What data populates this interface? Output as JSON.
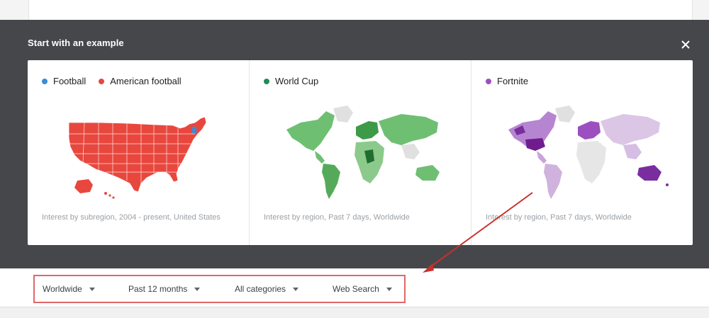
{
  "panel": {
    "title": "Start with an example",
    "close_icon": "close-icon"
  },
  "cards": [
    {
      "legend": [
        {
          "label": "Football",
          "color": "#3b8bd9"
        },
        {
          "label": "American football",
          "color": "#e8473e"
        }
      ],
      "caption": "Interest by subregion, 2004 - present, United States"
    },
    {
      "legend": [
        {
          "label": "World Cup",
          "color": "#1e8e5a"
        }
      ],
      "caption": "Interest by region, Past 7 days, Worldwide"
    },
    {
      "legend": [
        {
          "label": "Fortnite",
          "color": "#9c4fbf"
        }
      ],
      "caption": "Interest by region, Past 7 days, Worldwide"
    }
  ],
  "filters": [
    {
      "label": "Worldwide"
    },
    {
      "label": "Past 12 months"
    },
    {
      "label": "All categories"
    },
    {
      "label": "Web Search"
    }
  ],
  "colors": {
    "panel_bg": "#46474b",
    "highlight_box": "#e06769",
    "arrow": "#c9302c"
  }
}
